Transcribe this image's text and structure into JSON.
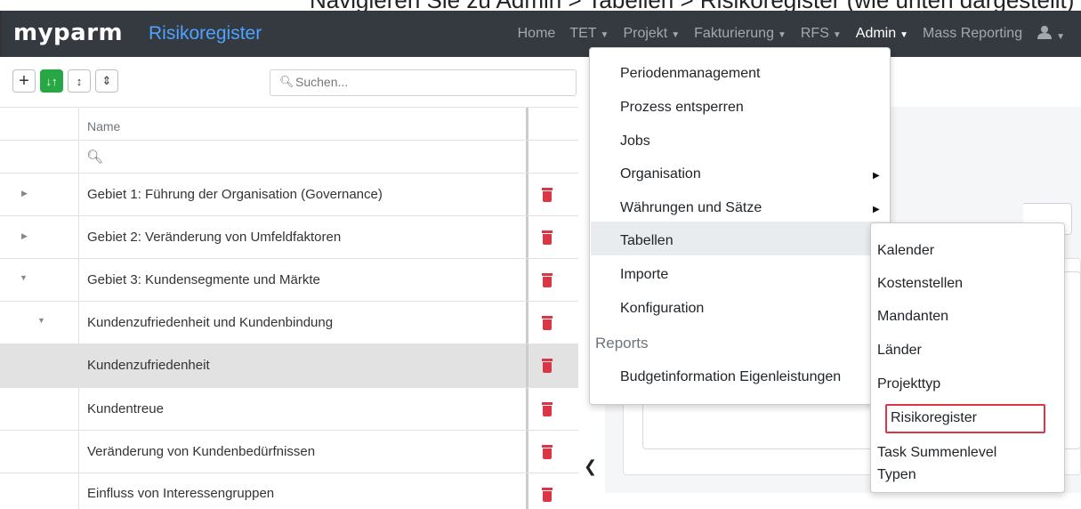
{
  "top_banner": "Navigieren Sie zu Admin > Tabellen > Risikoregister (wie unten dargestellt)",
  "navbar": {
    "brand": "myparm",
    "app_title": "Risikoregister",
    "items": [
      {
        "label": "Home",
        "dropdown": false,
        "active": false
      },
      {
        "label": "TET",
        "dropdown": true,
        "active": false
      },
      {
        "label": "Projekt",
        "dropdown": true,
        "active": false
      },
      {
        "label": "Fakturierung",
        "dropdown": true,
        "active": false
      },
      {
        "label": "RFS",
        "dropdown": true,
        "active": false
      },
      {
        "label": "Admin",
        "dropdown": true,
        "active": true
      },
      {
        "label": "Mass Reporting",
        "dropdown": false,
        "active": false
      }
    ],
    "user_icon": "user-icon"
  },
  "toolbar": {
    "add_icon": "plus-icon",
    "sort_icon": "sort-icon",
    "expand_icon": "expand-icon",
    "collapse_icon": "collapse-icon"
  },
  "search": {
    "placeholder": "Suchen...",
    "value": ""
  },
  "grid": {
    "header_name": "Name",
    "filter_icon": "search-icon",
    "rows": [
      {
        "name": "Gebiet 1: Führung der Organisation (Governance)",
        "expander": "collapsed",
        "level": 0,
        "selected": false
      },
      {
        "name": "Gebiet 2: Veränderung von Umfeldfaktoren",
        "expander": "collapsed",
        "level": 0,
        "selected": false
      },
      {
        "name": "Gebiet 3: Kundensegmente und Märkte",
        "expander": "expanded",
        "level": 0,
        "selected": false
      },
      {
        "name": "Kundenzufriedenheit und Kundenbindung",
        "expander": "expanded",
        "level": 1,
        "selected": false
      },
      {
        "name": "Kundenzufriedenheit",
        "expander": "none",
        "level": 2,
        "selected": true
      },
      {
        "name": "Kundentreue",
        "expander": "none",
        "level": 2,
        "selected": false
      },
      {
        "name": "Veränderung von Kundenbedürfnissen",
        "expander": "none",
        "level": 2,
        "selected": false
      },
      {
        "name": "Einfluss von Interessengruppen",
        "expander": "none",
        "level": 2,
        "selected": false
      }
    ]
  },
  "admin_menu": {
    "items": [
      {
        "label": "Periodenmanagement",
        "submenu": false
      },
      {
        "label": "Prozess entsperren",
        "submenu": false
      },
      {
        "label": "Jobs",
        "submenu": false
      },
      {
        "label": "Organisation",
        "submenu": true
      },
      {
        "label": "Währungen und Sätze",
        "submenu": true
      },
      {
        "label": "Tabellen",
        "submenu": false,
        "highlighted": true
      },
      {
        "label": "Importe",
        "submenu": false
      },
      {
        "label": "Konfiguration",
        "submenu": false
      }
    ],
    "reports_header": "Reports",
    "reports_items": [
      {
        "label": "Budgetinformation Eigenleistungen"
      }
    ]
  },
  "tabellen_submenu": {
    "items": [
      {
        "label": "Kalender"
      },
      {
        "label": "Kostenstellen"
      },
      {
        "label": "Mandanten"
      },
      {
        "label": "Länder"
      },
      {
        "label": "Projekttyp"
      },
      {
        "label": "Risikoregister",
        "highlighted": true
      },
      {
        "label": "Task Summenlevel"
      },
      {
        "label": "Typen"
      }
    ]
  },
  "colors": {
    "navbar": "#343a40",
    "brand_accent": "#4da3ff",
    "add_green": "#28a745",
    "delete_red": "#dc3545",
    "highlight_box": "#dc3545"
  }
}
